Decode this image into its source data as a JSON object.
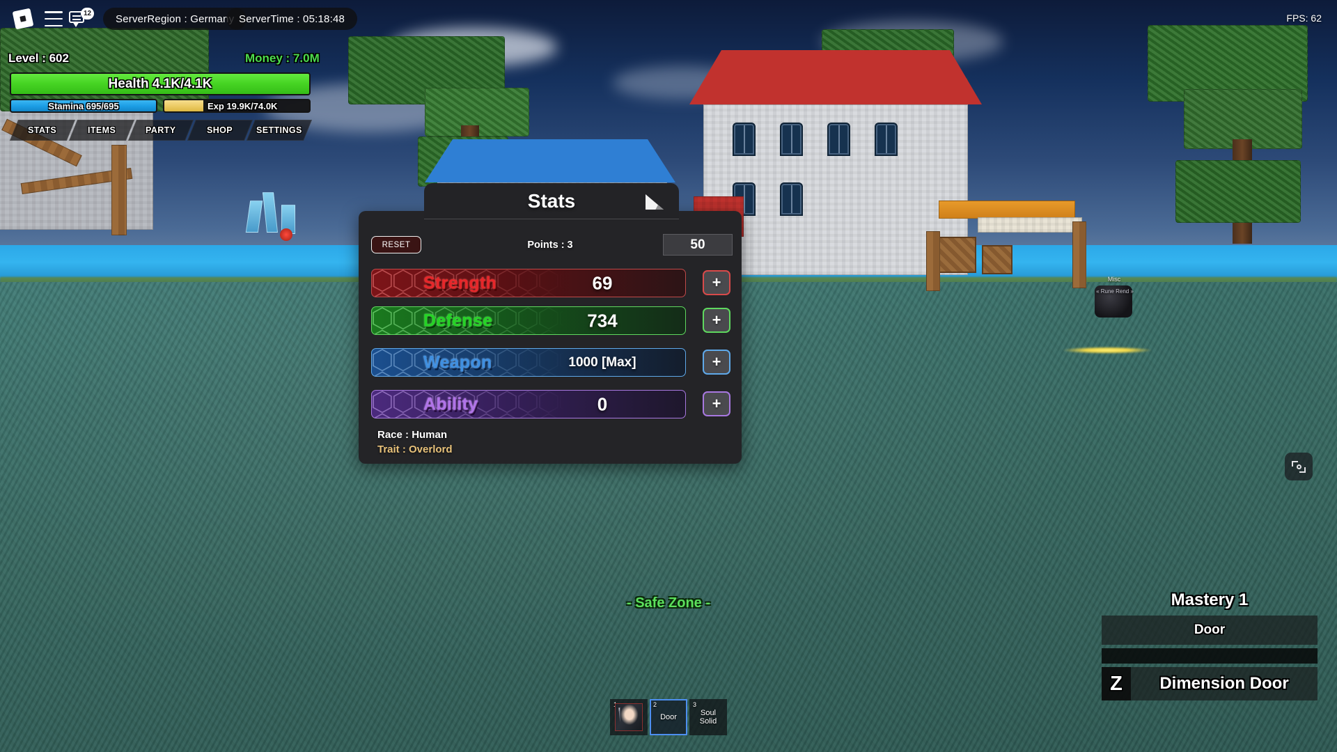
{
  "topbar": {
    "logo_icon": "roblox-logo-icon",
    "menu_icon": "hamburger-menu-icon",
    "chat_icon": "chat-bubble-icon",
    "chat_badge": "12",
    "server_region": "ServerRegion : Germany",
    "server_time": "ServerTime : 05:18:48",
    "fps": "FPS: 62"
  },
  "hud": {
    "level": "Level : 602",
    "money": "Money : 7.0M",
    "health": {
      "label": "Health 4.1K/4.1K",
      "fill_pct": 100,
      "color": "#46d423"
    },
    "stamina": {
      "label": "Stamina 695/695",
      "fill_pct": 100,
      "color": "#1d9fe6"
    },
    "exp": {
      "label": "Exp 19.9K/74.0K",
      "fill_pct": 27,
      "color": "#ecca63"
    },
    "tabs": [
      {
        "label": "STATS"
      },
      {
        "label": "ITEMS"
      },
      {
        "label": "PARTY"
      },
      {
        "label": "SHOP"
      },
      {
        "label": "SETTINGS"
      }
    ]
  },
  "stats_window": {
    "title": "Stats",
    "resize_icon": "resize-handle-icon",
    "reset_label": "RESET",
    "points_label": "Points : 3",
    "amount_value": "50",
    "rows": [
      {
        "name": "Strength",
        "value": "69",
        "plus": "+",
        "color": "#e8262a",
        "border": "#d84a4a",
        "bar_from": "#7d1418",
        "bar_to": "#2c1416"
      },
      {
        "name": "Defense",
        "value": "734",
        "plus": "+",
        "color": "#25d425",
        "border": "#5fd95f",
        "bar_from": "#1a7a1e",
        "bar_to": "#142c18"
      },
      {
        "name": "Weapon",
        "value": "1000 [Max]",
        "plus": "+",
        "color": "#3f8fe0",
        "border": "#5fa9ea",
        "bar_from": "#1b4f8f",
        "bar_to": "#141d2c"
      },
      {
        "name": "Ability",
        "value": "0",
        "plus": "+",
        "color": "#b073e8",
        "border": "#a878e0",
        "bar_from": "#4b2a7d",
        "bar_to": "#1e172c"
      }
    ],
    "race": "Race : Human",
    "trait": "Trait : Overlord",
    "trait_color": "#e8c27a"
  },
  "world": {
    "safe_zone": "- Safe Zone -",
    "npc_tag_top": "Misc",
    "npc_tag_bottom": "« Rune Rend »"
  },
  "mastery": {
    "title": "Mastery 1",
    "weapon_slot": "Door",
    "skill_key": "Z",
    "skill_name": "Dimension Door"
  },
  "hotbar": {
    "slots": [
      {
        "num": "1",
        "label": "",
        "icon": "fist-item-icon",
        "selected": false
      },
      {
        "num": "2",
        "label": "Door",
        "icon": "",
        "selected": true
      },
      {
        "num": "3",
        "label": "Soul Solid",
        "icon": "",
        "selected": false
      }
    ]
  },
  "camera_button": {
    "icon": "camera-focus-icon"
  }
}
